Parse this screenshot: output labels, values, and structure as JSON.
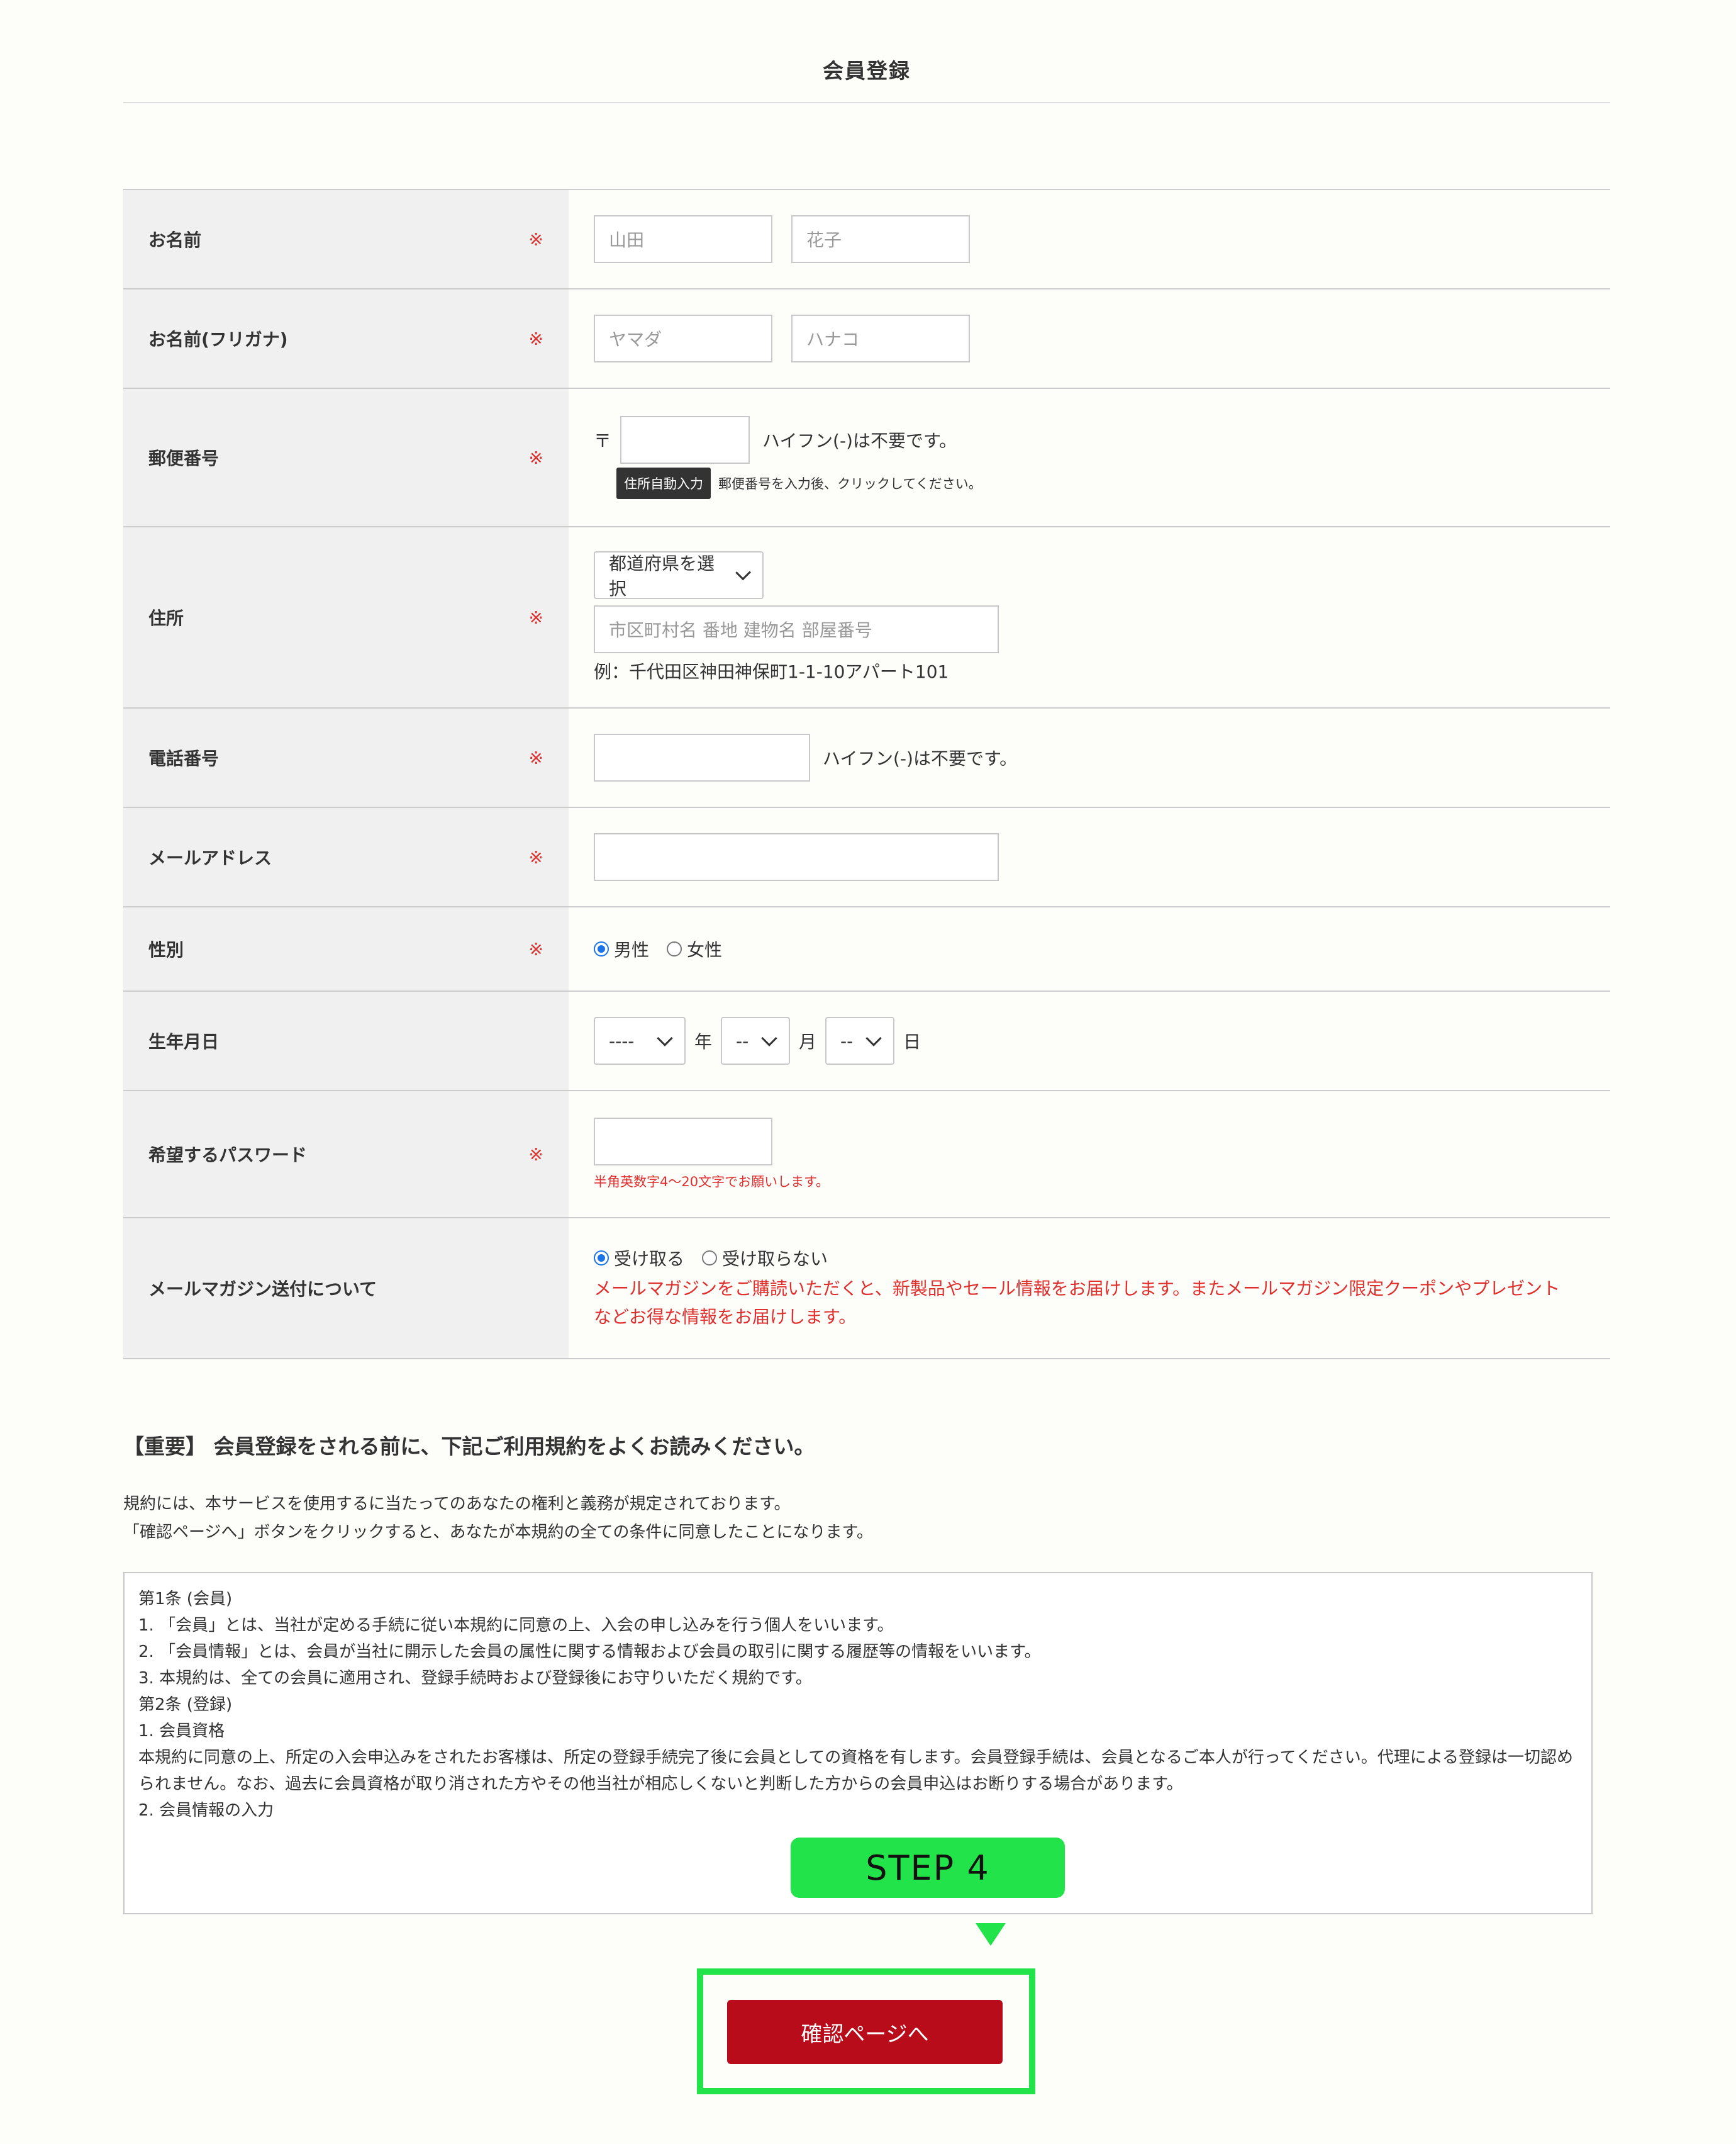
{
  "page_title": "会員登録",
  "required_mark": "※",
  "form": {
    "name": {
      "label": "お名前",
      "first_placeholder": "山田",
      "last_placeholder": "花子"
    },
    "kana": {
      "label": "お名前(フリガナ)",
      "first_placeholder": "ヤマダ",
      "last_placeholder": "ハナコ"
    },
    "postal": {
      "label": "郵便番号",
      "prefix": "〒",
      "hint": "ハイフン(-)は不要です。",
      "auto_button": "住所自動入力",
      "auto_hint": "郵便番号を入力後、クリックしてください。"
    },
    "address": {
      "label": "住所",
      "prefecture_select": "都道府県を選択",
      "placeholder": "市区町村名 番地 建物名 部屋番号",
      "example": "例：千代田区神田神保町1-1-10アパート101"
    },
    "phone": {
      "label": "電話番号",
      "hint": "ハイフン(-)は不要です。"
    },
    "email": {
      "label": "メールアドレス"
    },
    "gender": {
      "label": "性別",
      "options": [
        "男性",
        "女性"
      ],
      "selected": "男性"
    },
    "birthday": {
      "label": "生年月日",
      "year": "----",
      "year_unit": "年",
      "month": "--",
      "month_unit": "月",
      "day": "--",
      "day_unit": "日"
    },
    "password": {
      "label": "希望するパスワード",
      "hint": "半角英数字4〜20文字でお願いします。"
    },
    "newsletter": {
      "label": "メールマガジン送付について",
      "options": [
        "受け取る",
        "受け取らない"
      ],
      "selected": "受け取る",
      "note": "メールマガジンをご購読いただくと、新製品やセール情報をお届けします。またメールマガジン限定クーポンやプレゼントなどお得な情報をお届けします。"
    }
  },
  "terms": {
    "heading": "【重要】 会員登録をされる前に、下記ご利用規約をよくお読みください。",
    "intro_1": "規約には、本サービスを使用するに当たってのあなたの権利と義務が規定されております。",
    "intro_2": "「確認ページへ」ボタンをクリックすると、あなたが本規約の全ての条件に同意したことになります。",
    "lines": [
      "第1条 (会員)",
      "",
      "1. 「会員」とは、当社が定める手続に従い本規約に同意の上、入会の申し込みを行う個人をいいます。",
      "2. 「会員情報」とは、会員が当社に開示した会員の属性に関する情報および会員の取引に関する履歴等の情報をいいます。",
      "3. 本規約は、全ての会員に適用され、登録手続時および登録後にお守りいただく規約です。",
      "",
      "第2条 (登録)",
      "",
      "1. 会員資格",
      "本規約に同意の上、所定の入会申込みをされたお客様は、所定の登録手続完了後に会員としての資格を有します。会員登録手続は、会員となるご本人が行ってください。代理による登録は一切認められません。なお、過去に会員資格が取り消された方やその他当社が相応しくないと判断した方からの会員申込はお断りする場合があります。",
      "",
      "2. 会員情報の入力"
    ]
  },
  "step_label": "STEP 4",
  "submit_label": "確認ページへ",
  "colors": {
    "accent_green": "#22e34a",
    "submit_red": "#b80c1b",
    "required_red": "#e0302e"
  }
}
